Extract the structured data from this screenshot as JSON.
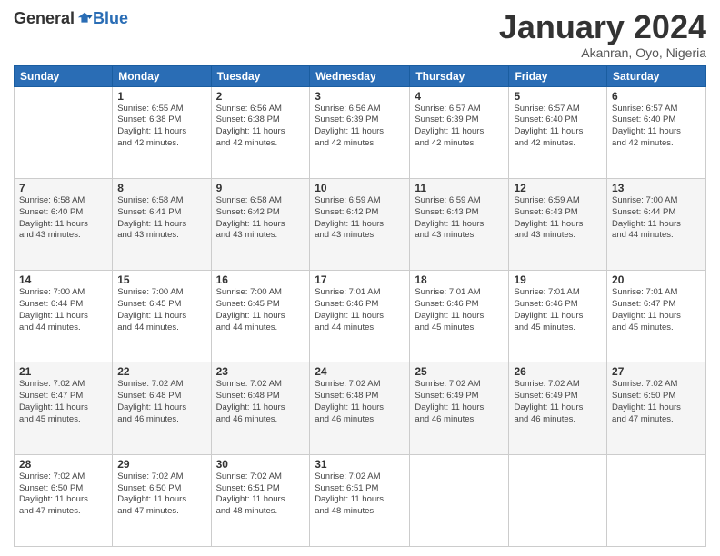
{
  "logo": {
    "general": "General",
    "blue": "Blue"
  },
  "header": {
    "month": "January 2024",
    "location": "Akanran, Oyo, Nigeria"
  },
  "days_of_week": [
    "Sunday",
    "Monday",
    "Tuesday",
    "Wednesday",
    "Thursday",
    "Friday",
    "Saturday"
  ],
  "weeks": [
    [
      {
        "day": "",
        "info": ""
      },
      {
        "day": "1",
        "info": "Sunrise: 6:55 AM\nSunset: 6:38 PM\nDaylight: 11 hours\nand 42 minutes."
      },
      {
        "day": "2",
        "info": "Sunrise: 6:56 AM\nSunset: 6:38 PM\nDaylight: 11 hours\nand 42 minutes."
      },
      {
        "day": "3",
        "info": "Sunrise: 6:56 AM\nSunset: 6:39 PM\nDaylight: 11 hours\nand 42 minutes."
      },
      {
        "day": "4",
        "info": "Sunrise: 6:57 AM\nSunset: 6:39 PM\nDaylight: 11 hours\nand 42 minutes."
      },
      {
        "day": "5",
        "info": "Sunrise: 6:57 AM\nSunset: 6:40 PM\nDaylight: 11 hours\nand 42 minutes."
      },
      {
        "day": "6",
        "info": "Sunrise: 6:57 AM\nSunset: 6:40 PM\nDaylight: 11 hours\nand 42 minutes."
      }
    ],
    [
      {
        "day": "7",
        "info": "Sunrise: 6:58 AM\nSunset: 6:40 PM\nDaylight: 11 hours\nand 43 minutes."
      },
      {
        "day": "8",
        "info": "Sunrise: 6:58 AM\nSunset: 6:41 PM\nDaylight: 11 hours\nand 43 minutes."
      },
      {
        "day": "9",
        "info": "Sunrise: 6:58 AM\nSunset: 6:42 PM\nDaylight: 11 hours\nand 43 minutes."
      },
      {
        "day": "10",
        "info": "Sunrise: 6:59 AM\nSunset: 6:42 PM\nDaylight: 11 hours\nand 43 minutes."
      },
      {
        "day": "11",
        "info": "Sunrise: 6:59 AM\nSunset: 6:43 PM\nDaylight: 11 hours\nand 43 minutes."
      },
      {
        "day": "12",
        "info": "Sunrise: 6:59 AM\nSunset: 6:43 PM\nDaylight: 11 hours\nand 43 minutes."
      },
      {
        "day": "13",
        "info": "Sunrise: 7:00 AM\nSunset: 6:44 PM\nDaylight: 11 hours\nand 44 minutes."
      }
    ],
    [
      {
        "day": "14",
        "info": "Sunrise: 7:00 AM\nSunset: 6:44 PM\nDaylight: 11 hours\nand 44 minutes."
      },
      {
        "day": "15",
        "info": "Sunrise: 7:00 AM\nSunset: 6:45 PM\nDaylight: 11 hours\nand 44 minutes."
      },
      {
        "day": "16",
        "info": "Sunrise: 7:00 AM\nSunset: 6:45 PM\nDaylight: 11 hours\nand 44 minutes."
      },
      {
        "day": "17",
        "info": "Sunrise: 7:01 AM\nSunset: 6:46 PM\nDaylight: 11 hours\nand 44 minutes."
      },
      {
        "day": "18",
        "info": "Sunrise: 7:01 AM\nSunset: 6:46 PM\nDaylight: 11 hours\nand 45 minutes."
      },
      {
        "day": "19",
        "info": "Sunrise: 7:01 AM\nSunset: 6:46 PM\nDaylight: 11 hours\nand 45 minutes."
      },
      {
        "day": "20",
        "info": "Sunrise: 7:01 AM\nSunset: 6:47 PM\nDaylight: 11 hours\nand 45 minutes."
      }
    ],
    [
      {
        "day": "21",
        "info": "Sunrise: 7:02 AM\nSunset: 6:47 PM\nDaylight: 11 hours\nand 45 minutes."
      },
      {
        "day": "22",
        "info": "Sunrise: 7:02 AM\nSunset: 6:48 PM\nDaylight: 11 hours\nand 46 minutes."
      },
      {
        "day": "23",
        "info": "Sunrise: 7:02 AM\nSunset: 6:48 PM\nDaylight: 11 hours\nand 46 minutes."
      },
      {
        "day": "24",
        "info": "Sunrise: 7:02 AM\nSunset: 6:48 PM\nDaylight: 11 hours\nand 46 minutes."
      },
      {
        "day": "25",
        "info": "Sunrise: 7:02 AM\nSunset: 6:49 PM\nDaylight: 11 hours\nand 46 minutes."
      },
      {
        "day": "26",
        "info": "Sunrise: 7:02 AM\nSunset: 6:49 PM\nDaylight: 11 hours\nand 46 minutes."
      },
      {
        "day": "27",
        "info": "Sunrise: 7:02 AM\nSunset: 6:50 PM\nDaylight: 11 hours\nand 47 minutes."
      }
    ],
    [
      {
        "day": "28",
        "info": "Sunrise: 7:02 AM\nSunset: 6:50 PM\nDaylight: 11 hours\nand 47 minutes."
      },
      {
        "day": "29",
        "info": "Sunrise: 7:02 AM\nSunset: 6:50 PM\nDaylight: 11 hours\nand 47 minutes."
      },
      {
        "day": "30",
        "info": "Sunrise: 7:02 AM\nSunset: 6:51 PM\nDaylight: 11 hours\nand 48 minutes."
      },
      {
        "day": "31",
        "info": "Sunrise: 7:02 AM\nSunset: 6:51 PM\nDaylight: 11 hours\nand 48 minutes."
      },
      {
        "day": "",
        "info": ""
      },
      {
        "day": "",
        "info": ""
      },
      {
        "day": "",
        "info": ""
      }
    ]
  ]
}
